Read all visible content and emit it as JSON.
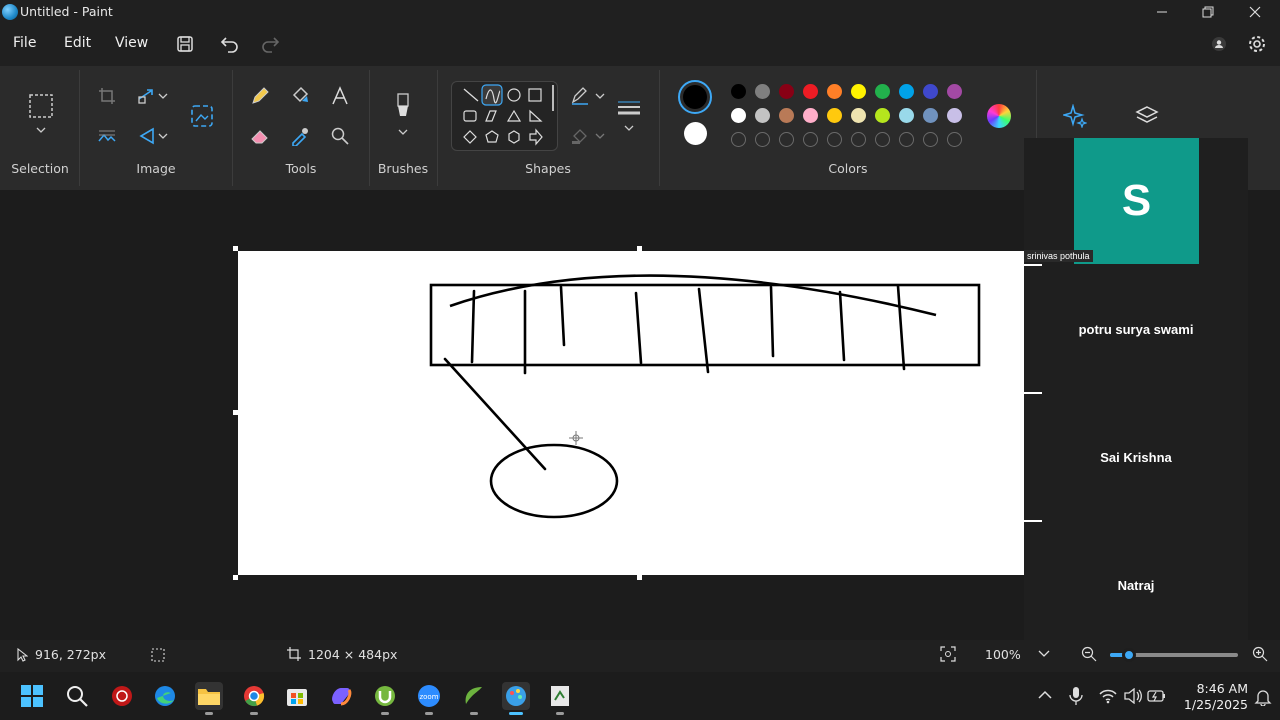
{
  "window": {
    "title": "Untitled - Paint"
  },
  "menu": {
    "file": "File",
    "edit": "Edit",
    "view": "View"
  },
  "ribbon": {
    "groups": {
      "selection": "Selection",
      "image": "Image",
      "tools": "Tools",
      "brushes": "Brushes",
      "shapes": "Shapes",
      "colors": "Colors"
    },
    "palette_row1": [
      "#000000",
      "#7f7f7f",
      "#880015",
      "#ed1c24",
      "#ff7f27",
      "#fff200",
      "#22b14c",
      "#00a2e8",
      "#3f48cc",
      "#a349a4"
    ],
    "palette_row2": [
      "#ffffff",
      "#c3c3c3",
      "#b97a57",
      "#ffaec9",
      "#ffc90e",
      "#efe4b0",
      "#b5e61d",
      "#99d9ea",
      "#7092be",
      "#c8bfe7"
    ],
    "primary_color": "#000000",
    "secondary_color": "#ffffff"
  },
  "meeting": {
    "avatar_initial": "S",
    "avatar_color": "#0f9a8a",
    "participants": [
      "srinivas pothula",
      "potru surya swami",
      "Sai Krishna",
      "Natraj"
    ]
  },
  "status": {
    "cursor_position": "916, 272px",
    "canvas_size": "1204 × 484px",
    "zoom": "100%",
    "zoom_level": 0.15
  },
  "clock": {
    "time": "8:46 AM",
    "date": "1/25/2025"
  }
}
